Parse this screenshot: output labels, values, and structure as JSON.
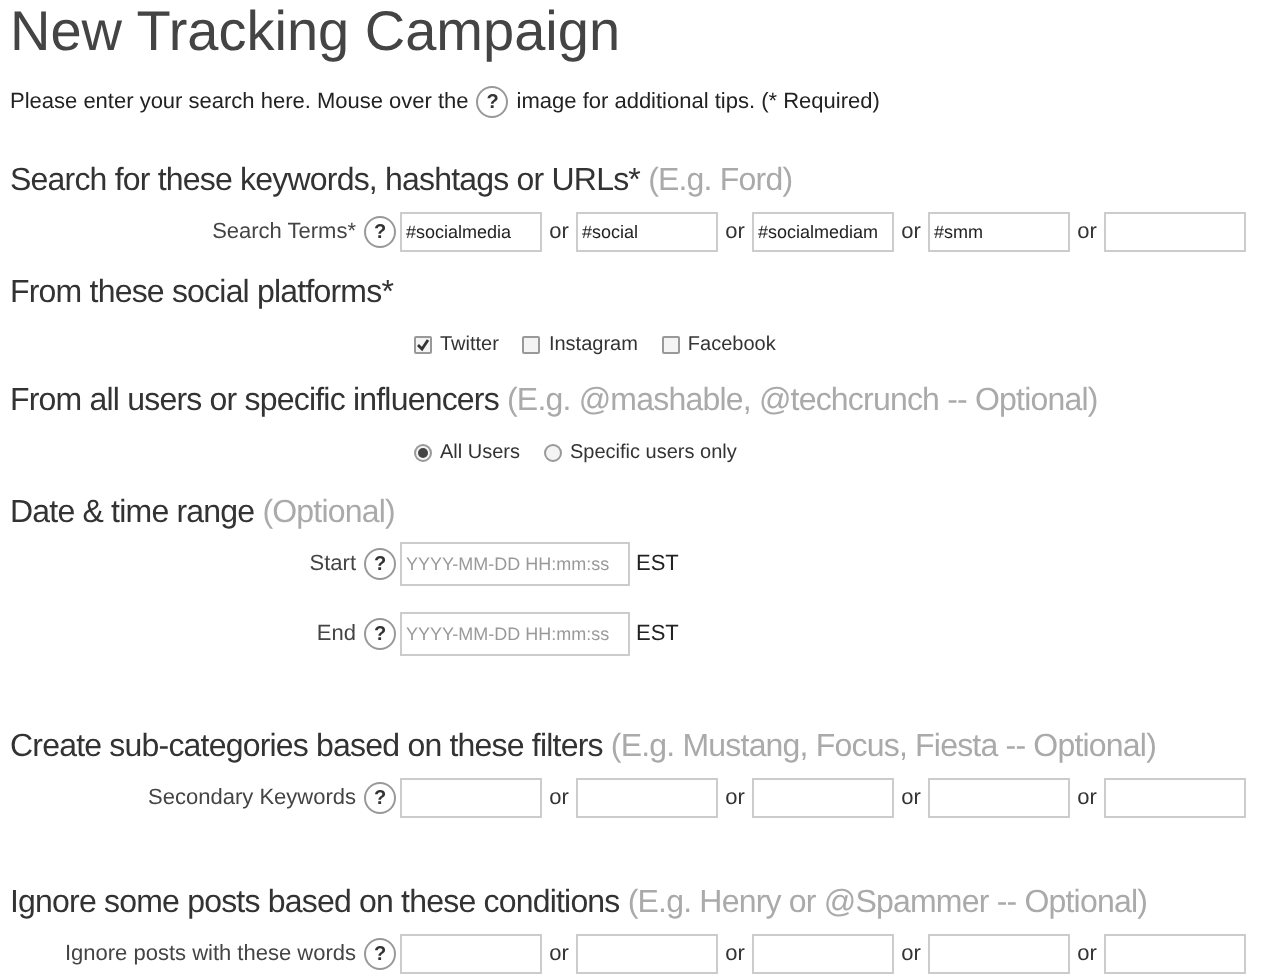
{
  "title": "New Tracking Campaign",
  "intro": {
    "before": "Please enter your search here. Mouse over the",
    "help": "?",
    "after": "image for additional tips. (* Required)"
  },
  "sections": [
    {
      "kind": "terms",
      "heading": "Search for these keywords, hashtags or URLs*",
      "hint": "(E.g. Ford)",
      "label": "Search Terms*",
      "help": "?",
      "items": [
        {
          "kind": "field",
          "value": "#socialmedia"
        },
        {
          "kind": "separator",
          "text": "or"
        },
        {
          "kind": "field",
          "value": "#social"
        },
        {
          "kind": "separator",
          "text": "or"
        },
        {
          "kind": "field",
          "value": "#socialmediam"
        },
        {
          "kind": "separator",
          "text": "or"
        },
        {
          "kind": "field",
          "value": "#smm"
        },
        {
          "kind": "separator",
          "text": "or"
        },
        {
          "kind": "field"
        }
      ]
    },
    {
      "kind": "checkboxes",
      "heading": "From these social platforms*",
      "options": [
        {
          "label": "Twitter",
          "checked": true
        },
        {
          "label": "Instagram",
          "checked": false
        },
        {
          "label": "Facebook",
          "checked": false
        }
      ]
    },
    {
      "kind": "radios",
      "heading": "From all users or specific influencers",
      "hint": "(E.g. @mashable, @techcrunch -- Optional)",
      "options": [
        {
          "label": "All Users",
          "selected": true
        },
        {
          "label": "Specific users only",
          "selected": false
        }
      ]
    },
    {
      "kind": "dates",
      "heading": "Date & time range",
      "hint": "(Optional)",
      "rows": [
        {
          "label": "Start",
          "help": "?",
          "placeholder": "YYYY-MM-DD HH:mm:ss",
          "zone": "EST"
        },
        {
          "label": "End",
          "help": "?",
          "placeholder": "YYYY-MM-DD HH:mm:ss",
          "zone": "EST"
        }
      ]
    },
    {
      "kind": "terms",
      "heading": "Create sub-categories based on these filters",
      "hint": "(E.g. Mustang, Focus, Fiesta -- Optional)",
      "label": "Secondary Keywords",
      "help": "?",
      "items": [
        {
          "kind": "field"
        },
        {
          "kind": "separator",
          "text": "or"
        },
        {
          "kind": "field"
        },
        {
          "kind": "separator",
          "text": "or"
        },
        {
          "kind": "field"
        },
        {
          "kind": "separator",
          "text": "or"
        },
        {
          "kind": "field"
        },
        {
          "kind": "separator",
          "text": "or"
        },
        {
          "kind": "field"
        }
      ]
    },
    {
      "kind": "terms",
      "heading": "Ignore some posts based on these conditions",
      "hint": "(E.g. Henry or @Spammer -- Optional)",
      "label": "Ignore posts with these words",
      "help": "?",
      "items": [
        {
          "kind": "field"
        },
        {
          "kind": "separator",
          "text": "or"
        },
        {
          "kind": "field"
        },
        {
          "kind": "separator",
          "text": "or"
        },
        {
          "kind": "field"
        },
        {
          "kind": "separator",
          "text": "or"
        },
        {
          "kind": "field"
        },
        {
          "kind": "separator",
          "text": "or"
        },
        {
          "kind": "field"
        }
      ]
    }
  ]
}
